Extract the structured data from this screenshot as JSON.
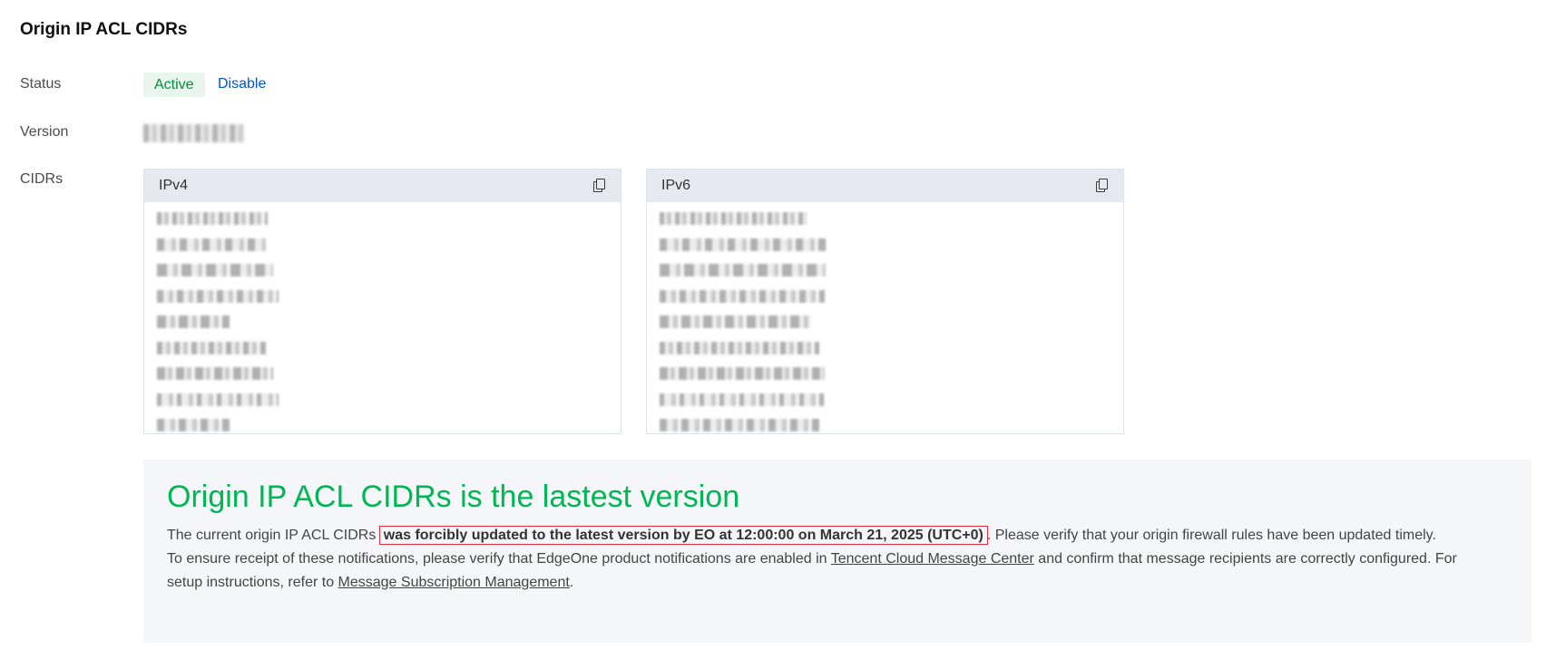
{
  "section": {
    "title": "Origin IP ACL CIDRs"
  },
  "rows": {
    "status_label": "Status",
    "version_label": "Version",
    "cidrs_label": "CIDRs"
  },
  "status": {
    "badge": "Active",
    "disable_link": "Disable",
    "badge_color": "#0a8a3e",
    "link_color": "#0052d9"
  },
  "cidrs": {
    "ipv4": {
      "header": "IPv4",
      "copy_icon": "copy-icon",
      "visible_rows": 9
    },
    "ipv6": {
      "header": "IPv6",
      "copy_icon": "copy-icon",
      "visible_rows": 9
    }
  },
  "notice": {
    "title": "Origin IP ACL CIDRs is the lastest version",
    "title_color": "#00b853",
    "line1_prefix": "The current origin IP ACL CIDRs ",
    "line1_highlight": "was forcibly updated to the latest version by EO at 12:00:00 on March 21, 2025 (UTC+0)",
    "line1_suffix": ". Please verify that your origin firewall rules have been updated timely.",
    "line2_prefix": "To ensure receipt of these notifications, please verify that EdgeOne product notifications are enabled in ",
    "link1": "Tencent Cloud Message Center",
    "line2_mid": " and confirm that message recipients are correctly configured. For setup instructions, refer to ",
    "link2": "Message Subscription Management",
    "line2_end": "."
  }
}
